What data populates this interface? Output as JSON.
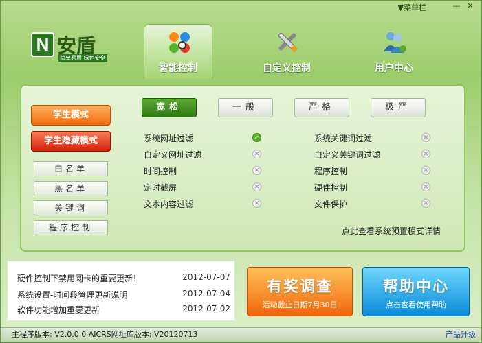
{
  "titlebar": {
    "menu_label": "▼菜单栏",
    "minimize_label": "—",
    "close_label": "✕"
  },
  "logo": {
    "mark": "N",
    "name": "安盾",
    "slogan": "简单易用 绿色安全"
  },
  "tabs": [
    {
      "label": "智能控制",
      "icon": "smart-control-icon"
    },
    {
      "label": "自定义控制",
      "icon": "wrench-screwdriver-icon"
    },
    {
      "label": "用户中心",
      "icon": "users-icon"
    }
  ],
  "sidebar": {
    "student_mode": "学生模式",
    "student_hidden_mode": "学生隐藏模式",
    "lists": [
      "白名单",
      "黑名单",
      "关键词",
      "程序控制"
    ]
  },
  "modes": [
    "宽松",
    "一般",
    "严格",
    "极严"
  ],
  "features_left": [
    {
      "label": "系统网址过滤",
      "on": true
    },
    {
      "label": "自定义网址过滤",
      "on": false
    },
    {
      "label": "时间控制",
      "on": false
    },
    {
      "label": "定时截屏",
      "on": false
    },
    {
      "label": "文本内容过滤",
      "on": false
    }
  ],
  "features_right": [
    {
      "label": "系统关键词过滤",
      "on": false
    },
    {
      "label": "自定义关键词过滤",
      "on": false
    },
    {
      "label": "程序控制",
      "on": false
    },
    {
      "label": "硬件控制",
      "on": false
    },
    {
      "label": "文件保护",
      "on": false
    }
  ],
  "preset_link": "点此查看系统预置模式详情",
  "news": [
    {
      "title": "硬件控制下禁用网卡的重要更新！",
      "date": "2012-07-07"
    },
    {
      "title": "系统设置-时间段管理更新说明",
      "date": "2012-07-04"
    },
    {
      "title": "软件功能增加重要更新",
      "date": "2012-07-02"
    }
  ],
  "promo_survey": {
    "title": "有奖调查",
    "subtitle": "活动截止日期7月30日"
  },
  "promo_help": {
    "title": "帮助中心",
    "subtitle": "点击查看使用帮助"
  },
  "footer": {
    "version": "主程序版本: V2.0.0.0  AICRS网址库版本: V20120713",
    "upgrade": "产品升级"
  },
  "colors": {
    "accent_green": "#2e7a13",
    "orange": "#ef6a0b",
    "blue": "#0a8ad7"
  }
}
